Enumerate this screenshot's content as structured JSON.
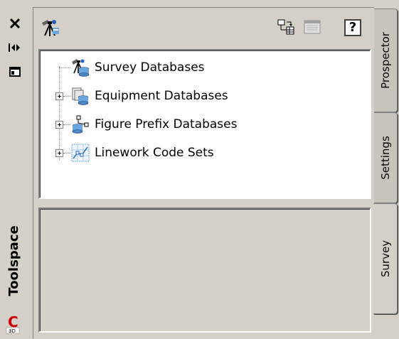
{
  "toolspace": {
    "title": "Toolspace",
    "badge": "C 3D",
    "controls": {
      "close_icon": "close-icon",
      "autohide_icon": "auto-hide-icon",
      "properties_icon": "properties-icon"
    }
  },
  "toolbar": {
    "surveyor_icon": "surveyor-icon",
    "help_label": "?"
  },
  "tree": {
    "items": [
      {
        "label": "Survey Databases",
        "icon": "survey-database-icon",
        "expandable": false
      },
      {
        "label": "Equipment Databases",
        "icon": "equipment-database-icon",
        "expandable": true
      },
      {
        "label": "Figure Prefix Databases",
        "icon": "figure-prefix-database-icon",
        "expandable": true
      },
      {
        "label": "Linework Code Sets",
        "icon": "linework-code-set-icon",
        "expandable": true
      }
    ]
  },
  "tabs": [
    {
      "label": "Prospector",
      "active": false
    },
    {
      "label": "Settings",
      "active": false
    },
    {
      "label": "Survey",
      "active": true
    }
  ],
  "colors": {
    "background": "#d4d0c8",
    "tree_background": "#ffffff",
    "badge_red": "#cc0000"
  }
}
